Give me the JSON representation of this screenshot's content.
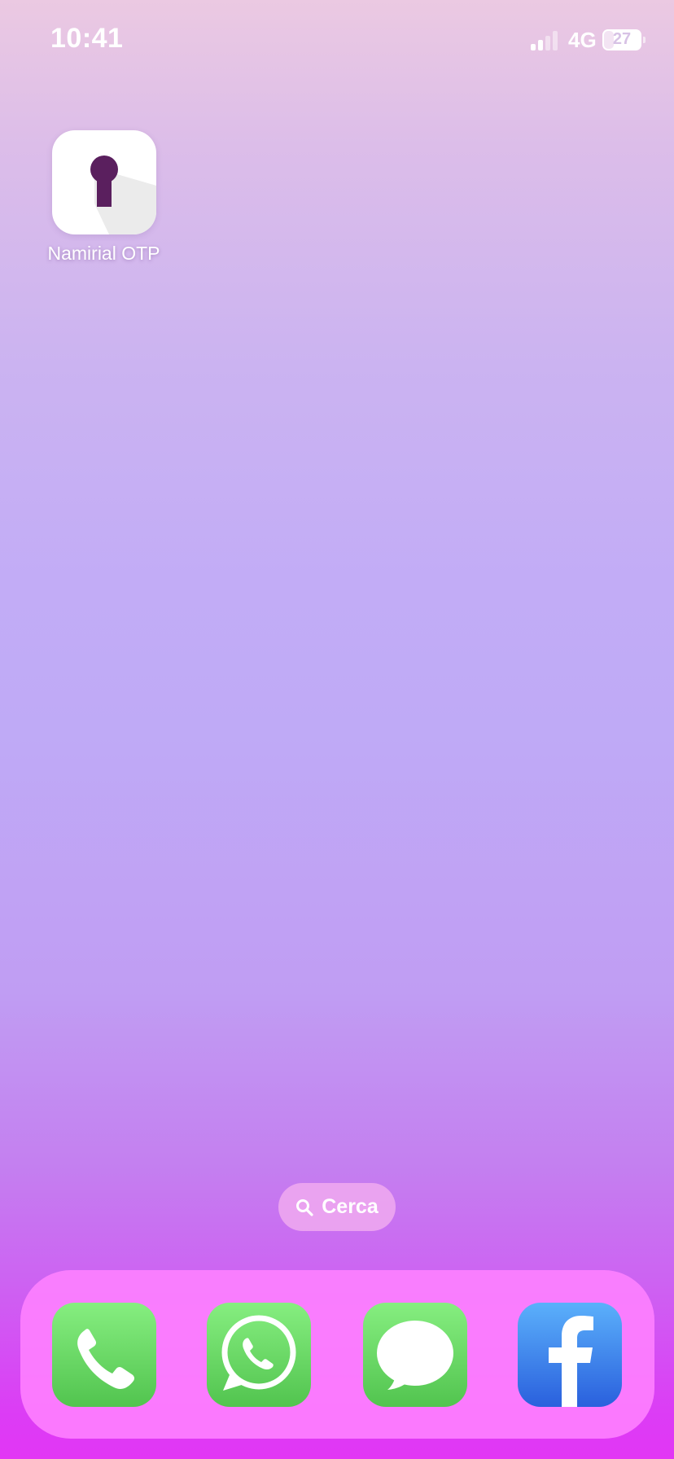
{
  "status_bar": {
    "time": "10:41",
    "network": "4G",
    "battery": "27",
    "battery_level": 0.27,
    "signal_bars_active": 2,
    "signal_bars_total": 4
  },
  "home_apps": [
    {
      "label": "Namirial OTP",
      "icon": "keyhole-icon",
      "accent": "#5a1f5e"
    }
  ],
  "search": {
    "label": "Cerca",
    "icon": "magnifier-icon"
  },
  "dock": [
    {
      "app": "Phone",
      "icon": "phone-icon"
    },
    {
      "app": "WhatsApp",
      "icon": "whatsapp-icon"
    },
    {
      "app": "Messages",
      "icon": "messages-icon"
    },
    {
      "app": "Facebook",
      "icon": "facebook-icon"
    }
  ],
  "colors": {
    "green_app": "#52c44f",
    "facebook_blue": "#2a60dd",
    "dock_background": "#ff82ff"
  }
}
